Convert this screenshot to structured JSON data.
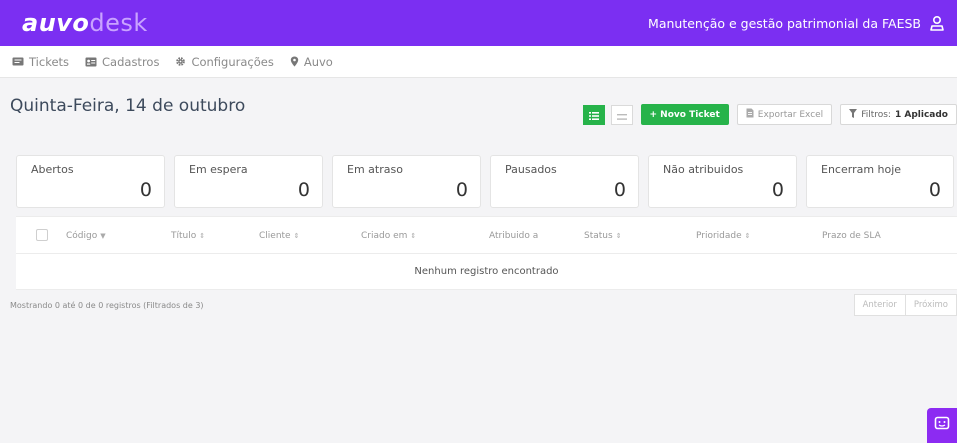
{
  "brand": {
    "part1": "auvo",
    "part2": "desk"
  },
  "header": {
    "org_name": "Manutenção e gestão patrimonial da FAESB"
  },
  "menu": {
    "items": [
      {
        "label": "Tickets",
        "icon": "ticket-icon"
      },
      {
        "label": "Cadastros",
        "icon": "id-card-icon"
      },
      {
        "label": "Configurações",
        "icon": "gear-icon"
      },
      {
        "label": "Auvo",
        "icon": "map-pin-icon"
      }
    ]
  },
  "page": {
    "date_title": "Quinta-Feira, 14 de outubro"
  },
  "toolbar": {
    "new_ticket": "+ Novo Ticket",
    "export": "Exportar Excel",
    "filters_prefix": "Filtros:",
    "filters_value": "1 Aplicado"
  },
  "cards": [
    {
      "label": "Abertos",
      "value": "0"
    },
    {
      "label": "Em espera",
      "value": "0"
    },
    {
      "label": "Em atraso",
      "value": "0"
    },
    {
      "label": "Pausados",
      "value": "0"
    },
    {
      "label": "Não atribuidos",
      "value": "0"
    },
    {
      "label": "Encerram hoje",
      "value": "0"
    }
  ],
  "table": {
    "columns": [
      {
        "label": "Código",
        "sort": "▼"
      },
      {
        "label": "Título",
        "sort": "⇕"
      },
      {
        "label": "Cliente",
        "sort": "⇕"
      },
      {
        "label": "Criado em",
        "sort": "⇕"
      },
      {
        "label": "Atribuido a",
        "sort": ""
      },
      {
        "label": "Status",
        "sort": "⇕"
      },
      {
        "label": "Prioridade",
        "sort": "⇕"
      },
      {
        "label": "Prazo de SLA",
        "sort": ""
      }
    ],
    "empty_message": "Nenhum registro encontrado"
  },
  "footer": {
    "info": "Mostrando 0 até 0 de 0 registros (Filtrados de 3)",
    "prev": "Anterior",
    "next": "Próximo"
  },
  "colors": {
    "brand": "#7b2ff2",
    "success": "#27b34a",
    "chat": "#8c2bf2"
  }
}
